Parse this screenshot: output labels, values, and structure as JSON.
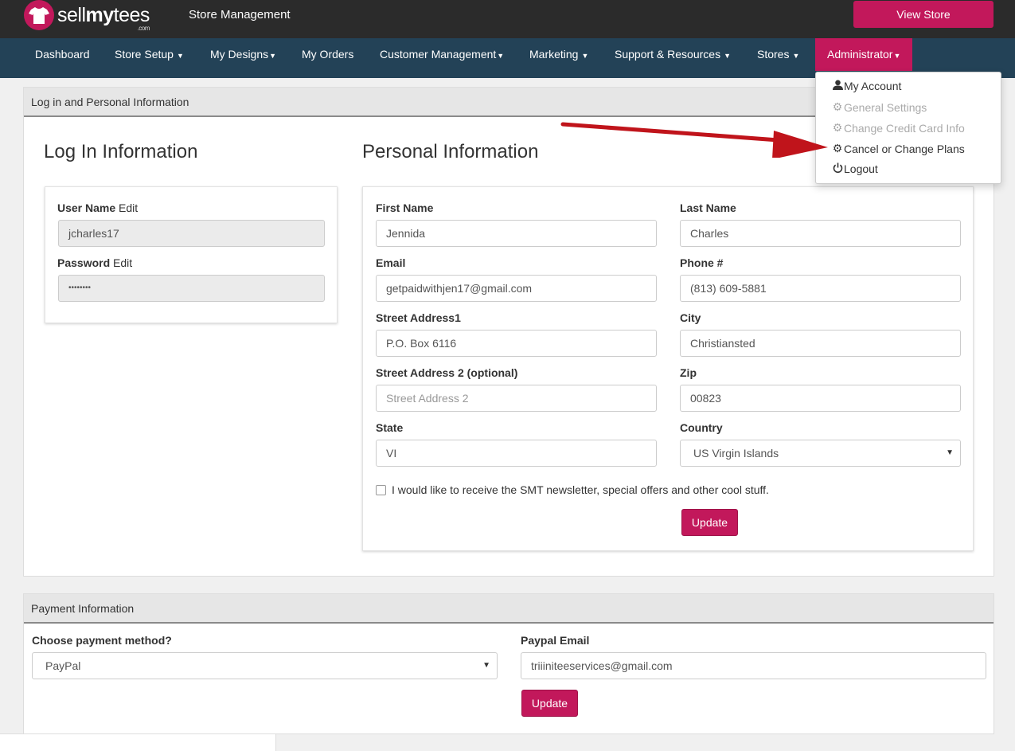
{
  "header": {
    "logo_sell": "sell",
    "logo_my": "my",
    "logo_tees": "tees",
    "logo_sub": ".com",
    "title": "Store Management",
    "view_store_label": "View Store"
  },
  "nav": {
    "items": [
      {
        "label": "Dashboard"
      },
      {
        "label": "Store Setup"
      },
      {
        "label": "My Designs"
      },
      {
        "label": "My Orders"
      },
      {
        "label": "Customer Management"
      },
      {
        "label": "Marketing"
      },
      {
        "label": "Support & Resources"
      },
      {
        "label": "Stores"
      },
      {
        "label": "Administrator"
      }
    ]
  },
  "admin_menu": {
    "items": [
      {
        "label": "My Account",
        "icon": "user-icon"
      },
      {
        "label": "General Settings",
        "icon": "gear-icon"
      },
      {
        "label": "Change Credit Card Info",
        "icon": "gear-icon"
      },
      {
        "label": "Cancel or Change Plans",
        "icon": "gear-icon"
      },
      {
        "label": "Logout",
        "icon": "power-icon"
      }
    ]
  },
  "personal_panel": {
    "heading": "Log in and Personal Information",
    "login_title": "Log In Information",
    "personal_title": "Personal Information",
    "username_label": "User Name",
    "username_edit": "Edit",
    "username_value": "jcharles17",
    "password_label": "Password",
    "password_edit": "Edit",
    "password_value": "••••••••",
    "first_name_label": "First Name",
    "first_name_value": "Jennida",
    "last_name_label": "Last Name",
    "last_name_value": "Charles",
    "email_label": "Email",
    "email_value": "getpaidwithjen17@gmail.com",
    "phone_label": "Phone #",
    "phone_value": "(813) 609-5881",
    "street1_label": "Street Address1",
    "street1_value": "P.O. Box 6116",
    "city_label": "City",
    "city_value": "Christiansted",
    "street2_label": "Street Address 2 (optional)",
    "street2_placeholder": "Street Address 2",
    "zip_label": "Zip",
    "zip_value": "00823",
    "state_label": "State",
    "state_value": "VI",
    "country_label": "Country",
    "country_value": "US Virgin Islands",
    "newsletter_label": "I would like to receive the SMT newsletter, special offers and other cool stuff.",
    "update_label": "Update"
  },
  "payment_panel": {
    "heading": "Payment Information",
    "method_label": "Choose payment method?",
    "method_value": "PayPal",
    "paypal_email_label": "Paypal Email",
    "paypal_email_value": "triiiniteeservices@gmail.com",
    "update_label": "Update"
  },
  "colors": {
    "brand": "#c2185b",
    "nav_bg": "#234257",
    "top_bg": "#2b2b2b",
    "arrow": "#c0141b"
  }
}
